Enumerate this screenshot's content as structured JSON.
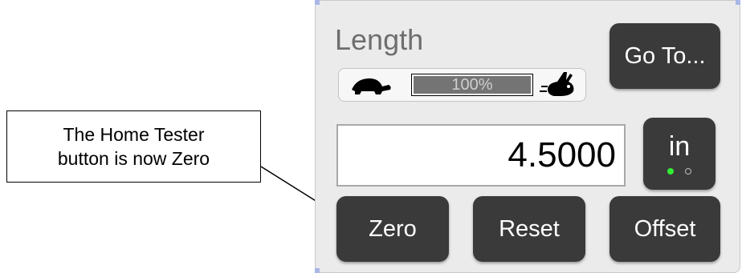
{
  "annotation": {
    "text": "The Home Tester\nbutton is now Zero"
  },
  "panel": {
    "title": "Length",
    "goto_label": "Go To...",
    "speed": {
      "percent_label": "100%",
      "level": 1.0,
      "slow_icon": "turtle-icon",
      "fast_icon": "rabbit-icon"
    },
    "readout": {
      "value": "4.5000"
    },
    "unit": {
      "label": "in",
      "indicators": [
        {
          "state": "on",
          "color": "#33ee33"
        },
        {
          "state": "off"
        }
      ]
    },
    "buttons": {
      "zero": "Zero",
      "reset": "Reset",
      "offset": "Offset"
    }
  }
}
